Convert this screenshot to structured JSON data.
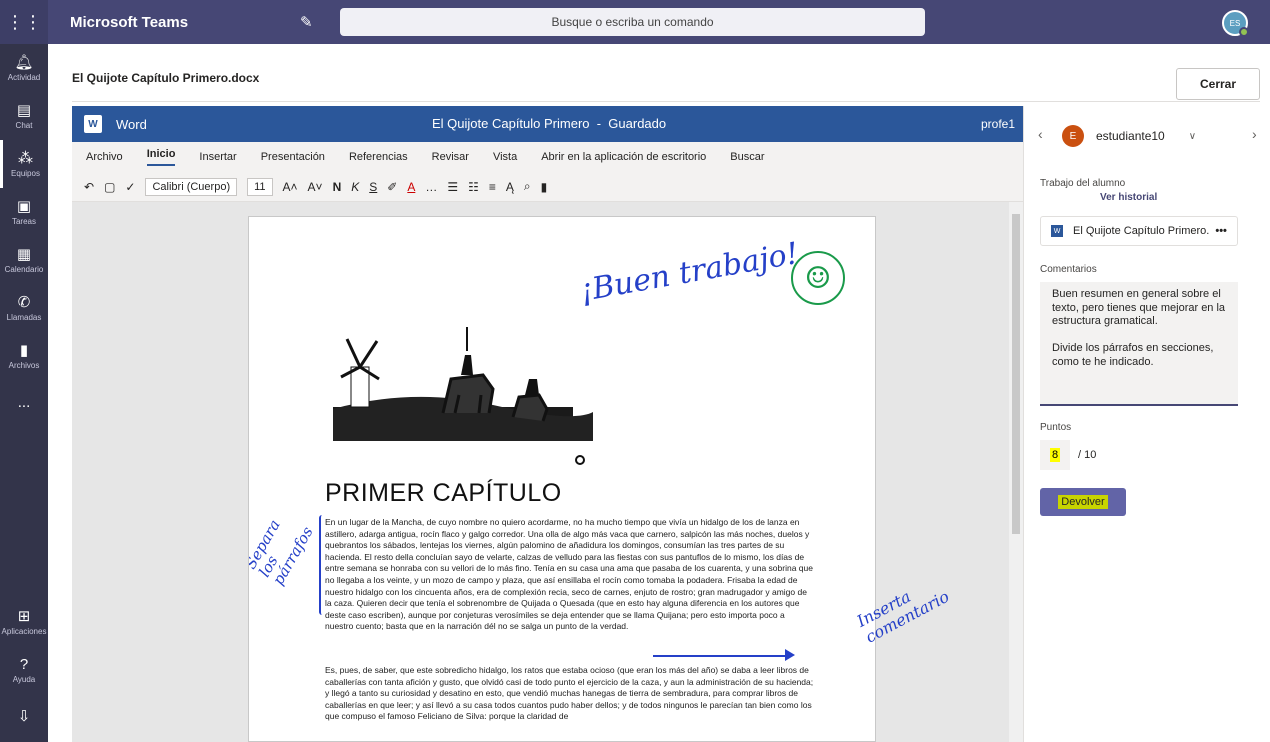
{
  "topbar": {
    "app_name": "Microsoft Teams",
    "search_placeholder": "Busque o escriba un comando"
  },
  "rail": {
    "items": [
      {
        "label": "Actividad",
        "icon": "bell-icon"
      },
      {
        "label": "Chat",
        "icon": "chat-icon"
      },
      {
        "label": "Equipos",
        "icon": "teams-icon"
      },
      {
        "label": "Tareas",
        "icon": "assignments-icon"
      },
      {
        "label": "Calendario",
        "icon": "calendar-icon"
      },
      {
        "label": "Llamadas",
        "icon": "phone-icon"
      },
      {
        "label": "Archivos",
        "icon": "files-icon"
      }
    ],
    "more": "...",
    "bottom": [
      {
        "label": "Aplicaciones",
        "icon": "apps-icon"
      },
      {
        "label": "Ayuda",
        "icon": "help-icon"
      }
    ]
  },
  "docbar": {
    "file_name": "El Quijote Capítulo Primero.docx",
    "close_label": "Cerrar"
  },
  "word": {
    "app_label": "Word",
    "doc_title": "El Quijote Capítulo Primero",
    "save_status": "Guardado",
    "user": "profe1",
    "tabs": [
      "Archivo",
      "Inicio",
      "Insertar",
      "Presentación",
      "Referencias",
      "Revisar",
      "Vista",
      "Abrir en la aplicación de escritorio",
      "Buscar"
    ],
    "font_name": "Calibri (Cuerpo)",
    "font_size": "11"
  },
  "document": {
    "heading": "PRIMER CAPÍTULO",
    "paragraph_1": "En un lugar de la Mancha, de cuyo nombre no quiero acordarme, no ha mucho tiempo que vivía un hidalgo de los de lanza en astillero, adarga antigua, rocín flaco y galgo corredor. Una olla de algo más vaca que carnero, salpicón las más noches, duelos y quebrantos los sábados, lentejas los viernes, algún palomino de añadidura los domingos, consumían las tres partes de su hacienda. El resto della concluían sayo de velarte, calzas de velludo para las fiestas con sus pantuflos de lo mismo, los días de entre semana se honraba con su vellori de lo más fino. Tenía en su casa una ama que pasaba de los cuarenta, y una sobrina que no llegaba a los veinte, y un mozo de campo y plaza, que así ensillaba el rocín como tomaba la podadera. Frisaba la edad de nuestro hidalgo con los cincuenta años, era de complexión recia, seco de carnes, enjuto de rostro; gran madrugador y amigo de la caza. Quieren decir que tenía el sobrenombre de Quijada o Quesada (que en esto hay alguna diferencia en los autores que deste caso escriben), aunque por conjeturas verosímiles se deja entender que se llama Quijana; pero esto importa poco a nuestro cuento; basta que en la narración dél no se salga un punto de la verdad.",
    "paragraph_2": "Es, pues, de saber, que este sobredicho hidalgo, los ratos que estaba ocioso (que eran los más del año) se daba a leer libros de caballerías con tanta afición y gusto, que olvidó casi de todo punto el ejercicio de la caza, y aun la administración de su hacienda; y llegó a tanto su curiosidad y desatino en esto, que vendió muchas hanegas de tierra de sembradura, para comprar libros de caballerías en que leer; y así llevó a su casa todos cuantos pudo haber dellos; y de todos ningunos le parecían tan bien como los que compuso el famoso Feliciano de Silva: porque la claridad de",
    "ink_praise": "¡Buen trabajo!",
    "ink_smiley": "☺",
    "ink_left": "Separa los párrafos",
    "ink_right": "Inserta comentario"
  },
  "side": {
    "student_initial": "E",
    "student_name": "estudiante10",
    "work_label": "Trabajo del alumno",
    "history_link": "Ver historial",
    "file_name": "El Quijote Capítulo Primero.",
    "file_more": "•••",
    "comments_label": "Comentarios",
    "comment_text": "Buen resumen en general sobre el texto, pero tienes que mejorar en la estructura gramatical.\n\nDivide los párrafos en secciones, como te he indicado.",
    "points_label": "Puntos",
    "points_value": "8",
    "points_max": "/ 10",
    "return_label": "Devolver"
  }
}
